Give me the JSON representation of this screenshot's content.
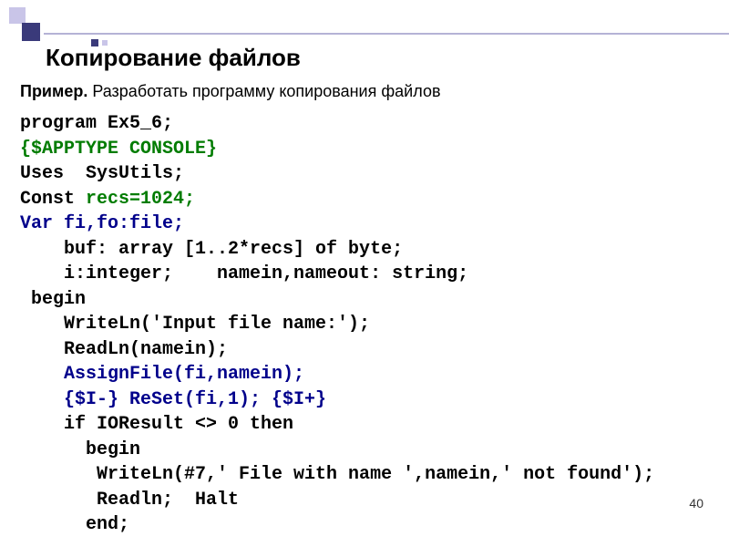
{
  "decoration": {},
  "title": "Копирование файлов",
  "subtitle_bold": "Пример.",
  "subtitle_rest": " Разработать программу копирования файлов",
  "code": {
    "l1_a": "program",
    "l1_b": " Ex5_6;",
    "l2": "{$APPTYPE CONSOLE}",
    "l3_a": "Uses",
    "l3_b": "  SysUtils;",
    "l4_a": "Const",
    "l4_b": " recs=1024;",
    "l5_a": "Var",
    "l5_b": " fi,fo:file;",
    "l6": "    buf: array [1..2*recs] of byte;",
    "l7": "    i:integer;    namein,nameout: string;",
    "l8": " begin",
    "l9": "    WriteLn('Input file name:');",
    "l10": "    ReadLn(namein);",
    "l11": "    AssignFile(fi,namein);",
    "l12": "    {$I-} ReSet(fi,1); {$I+}",
    "l13": "    if IOResult <> 0 then",
    "l14": "      begin",
    "l15": "       WriteLn(#7,' File with name ',namein,' not found');",
    "l16": "       Readln;  Halt",
    "l17": "      end;"
  },
  "page_number": "40"
}
